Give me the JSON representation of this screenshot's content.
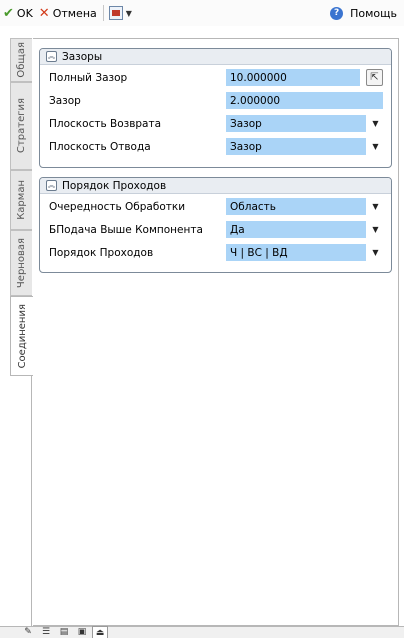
{
  "toolbar": {
    "ok_label": "OK",
    "cancel_label": "Отмена",
    "help_label": "Помощь"
  },
  "vertical_tabs": [
    {
      "label": "Общая",
      "active": false
    },
    {
      "label": "Стратегия",
      "active": false
    },
    {
      "label": "Карман",
      "active": false
    },
    {
      "label": "Черновая",
      "active": false
    },
    {
      "label": "Соединения",
      "active": true
    }
  ],
  "groups": {
    "clearances": {
      "title": "Зазоры",
      "full_clearance_label": "Полный Зазор",
      "full_clearance_value": "10.000000",
      "clearance_label": "Зазор",
      "clearance_value": "2.000000",
      "return_plane_label": "Плоскость Возврата",
      "return_plane_value": "Зазор",
      "retract_plane_label": "Плоскость Отвода",
      "retract_plane_value": "Зазор"
    },
    "pass_order": {
      "title": "Порядок Проходов",
      "machining_order_label": "Очередность Обработки",
      "machining_order_value": "Область",
      "feed_above_label": "БПодача Выше Компонента",
      "feed_above_value": "Да",
      "pass_order_label": "Порядок Проходов",
      "pass_order_value": "Ч | ВС | ВД"
    }
  },
  "bottom_tabs": [
    {
      "icon": "tool-icon",
      "active": false
    },
    {
      "icon": "list-icon",
      "active": false
    },
    {
      "icon": "sheet-icon",
      "active": false
    },
    {
      "icon": "image-icon",
      "active": false
    },
    {
      "icon": "machine-icon",
      "active": true
    }
  ],
  "colors": {
    "value_field": "#aad4f7",
    "group_border": "#7c8a99",
    "group_header": "#e9edf2"
  }
}
